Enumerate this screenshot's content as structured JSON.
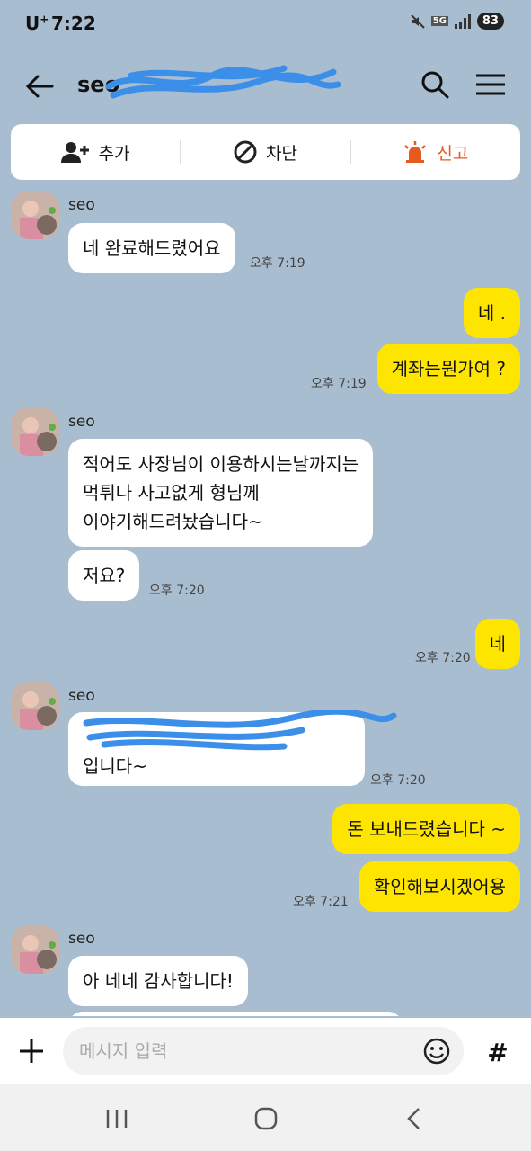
{
  "status": {
    "carrier": "U",
    "carrier_sup": "+",
    "time": "7:22",
    "network": "5G",
    "battery": "83"
  },
  "header": {
    "title": "seo"
  },
  "actions": {
    "add": "추가",
    "block": "차단",
    "report": "신고"
  },
  "messages": [
    {
      "sender": "seo"
    },
    {
      "text": "네 완료해드렸어요",
      "time": "오후 7:19"
    },
    {
      "text": "네 ."
    },
    {
      "text": "계좌는뭔가여 ?",
      "time": "오후 7:19"
    },
    {
      "sender": "seo"
    },
    {
      "lines": [
        "적어도 사장님이 이용하시는날까지는",
        "먹튀나 사고없게 형님께",
        "이야기해드려놨습니다~"
      ]
    },
    {
      "text": "저요?",
      "time": "오후 7:20"
    },
    {
      "text": "네",
      "time": "오후 7:20"
    },
    {
      "sender": "seo"
    },
    {
      "lines": [
        "입니다~"
      ],
      "time": "오후 7:20"
    },
    {
      "text": "돈 보내드렸습니다 ~"
    },
    {
      "text": "확인해보시겠어용",
      "time": "오후 7:21"
    },
    {
      "sender": "seo"
    },
    {
      "text": "아 네네 감사합니다!"
    }
  ],
  "input": {
    "placeholder": "메시지 입력",
    "hash": "#"
  },
  "colors": {
    "background": "#a9bdd0",
    "outgoing": "#fee500",
    "incoming": "#ffffff",
    "report": "#e65a1e"
  }
}
